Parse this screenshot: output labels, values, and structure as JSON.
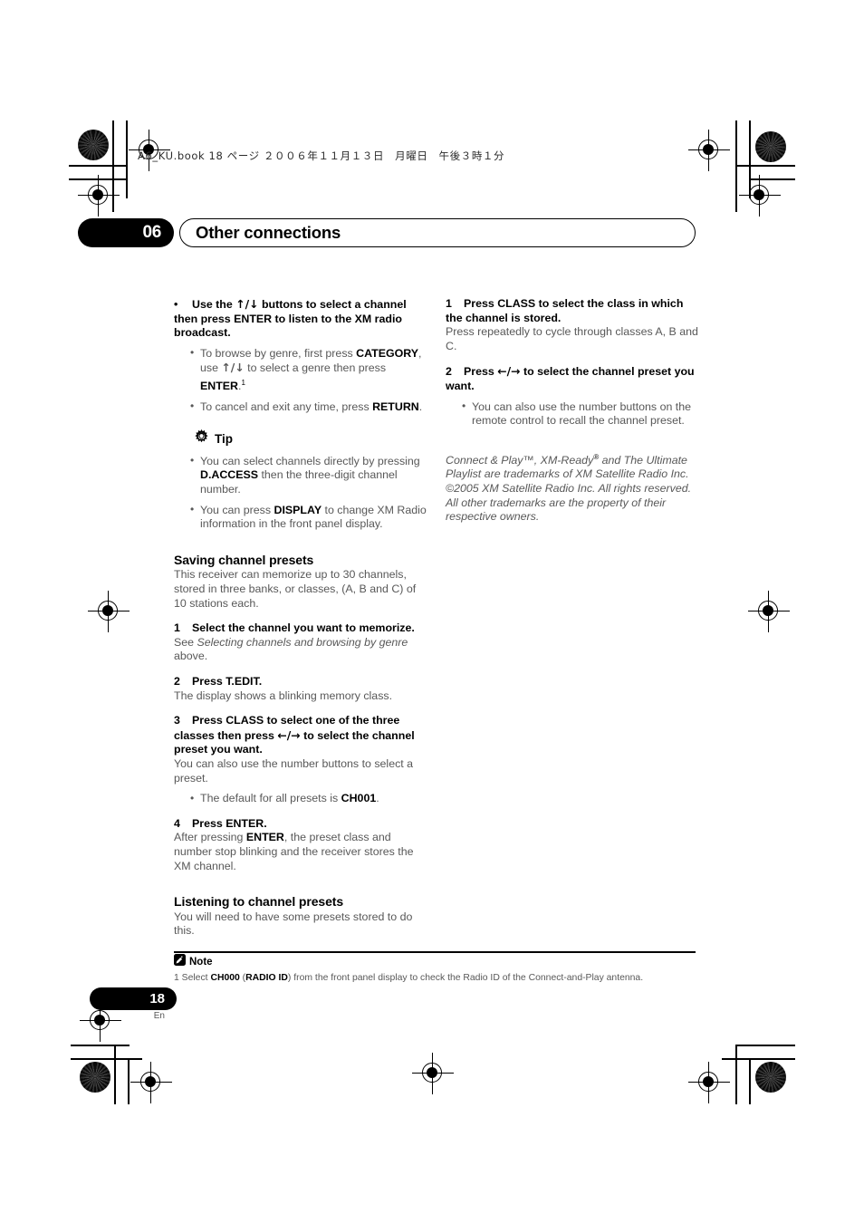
{
  "print_header": {
    "text": "A6_KU.book  18 ページ  ２００６年１１月１３日　月曜日　午後３時１分"
  },
  "chapter": {
    "number": "06",
    "title": "Other connections"
  },
  "left_column": {
    "bullet_step": {
      "marker": "•",
      "text_1": "Use the ",
      "arrows": "↑/↓",
      "text_2": " buttons to select a channel then press ENTER to listen to the XM radio broadcast."
    },
    "bullet_step_subs": [
      {
        "seg1": "To browse by genre, first press ",
        "bold1": "CATEGORY",
        "seg2": ", use ",
        "arrows": "↑/↓",
        "seg3": " to select a genre then press ",
        "bold2": "ENTER",
        "seg4": ".",
        "footnote": "1"
      },
      {
        "seg1": "To cancel and exit any time, press ",
        "bold1": "RETURN",
        "seg2": "."
      }
    ],
    "tip": {
      "icon": "lightbulb-icon",
      "label": "Tip",
      "items": [
        {
          "seg1": "You can select channels directly by pressing ",
          "bold1": "D.ACCESS",
          "seg2": " then the three-digit channel number."
        },
        {
          "seg1": "You can press ",
          "bold1": "DISPLAY",
          "seg2": " to change XM Radio information in the front panel display."
        }
      ]
    },
    "saving_presets": {
      "heading": "Saving channel presets",
      "intro": "This receiver can memorize up to 30 channels, stored in three banks, or classes, (A, B and C) of 10 stations each.",
      "steps": [
        {
          "number": "1",
          "title": "Select the channel you want to memorize.",
          "body_pre": "See ",
          "body_italic": "Selecting channels and browsing by genre",
          "body_post": " above."
        },
        {
          "number": "2",
          "title": "Press T.EDIT.",
          "body": "The display shows a blinking memory class."
        },
        {
          "number": "3",
          "title_1": "Press CLASS to select one of the three classes then press ",
          "arrows": "←/→",
          "title_2": " to select the channel preset you want.",
          "body": "You can also use the number buttons to select a preset.",
          "sub": {
            "seg1": "The default for all presets is ",
            "bold1": "CH001",
            "seg2": "."
          }
        },
        {
          "number": "4",
          "title": "Press ENTER.",
          "body_pre": "After pressing ",
          "body_bold": "ENTER",
          "body_post": ", the preset class and number stop blinking and the receiver stores the XM channel."
        }
      ]
    },
    "listening_presets": {
      "heading": "Listening to channel presets",
      "body": "You will need to have some presets stored to do this."
    }
  },
  "right_column": {
    "steps": [
      {
        "number": "1",
        "title": "Press CLASS to select the class in which the channel is stored.",
        "body": "Press repeatedly to cycle through classes A, B and C."
      },
      {
        "number": "2",
        "title_1": "Press ",
        "arrows": "←/→",
        "title_2": " to select the channel preset you want.",
        "sub": "You can also use the number buttons on the remote control to recall the channel preset."
      }
    ],
    "trademark": {
      "seg1": "Connect & Play™, XM-Ready",
      "sup": "®",
      "seg2": " and The Ultimate Playlist are trademarks of XM Satellite Radio Inc. ©2005 XM Satellite Radio Inc. All rights reserved. All other trademarks are the property of their respective owners."
    }
  },
  "note": {
    "icon": "note-pencil-icon",
    "label": "Note",
    "seg1": "1 Select ",
    "bold1": "CH000",
    "seg2": " (",
    "bold2": "RADIO ID",
    "seg3": ") from the front panel display to check the Radio ID of the Connect-and-Play antenna."
  },
  "footer": {
    "page_number": "18",
    "language": "En"
  },
  "colors": {
    "ink_black": "#000000",
    "body_gray": "#585858",
    "page_white": "#ffffff"
  }
}
